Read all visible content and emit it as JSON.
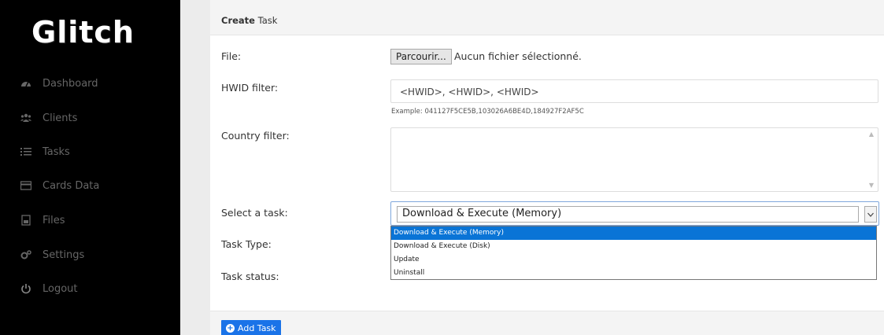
{
  "sidebar": {
    "logo": "Glitch",
    "items": [
      {
        "label": "Dashboard",
        "icon": "dashboard-icon"
      },
      {
        "label": "Clients",
        "icon": "users-icon"
      },
      {
        "label": "Tasks",
        "icon": "list-icon"
      },
      {
        "label": "Cards Data",
        "icon": "credit-card-icon"
      },
      {
        "label": "Files",
        "icon": "file-icon"
      },
      {
        "label": "Settings",
        "icon": "gears-icon"
      },
      {
        "label": "Logout",
        "icon": "power-icon"
      }
    ]
  },
  "card": {
    "title_bold": "Create",
    "title_rest": " Task"
  },
  "form": {
    "file_label": "File:",
    "file_button": "Parcourir...",
    "file_status": "Aucun fichier sélectionné.",
    "hwid_label": "HWID filter:",
    "hwid_value": "<HWID>, <HWID>, <HWID>",
    "hwid_hint": "Example: 041127F5CE5B,103026A6BE4D,184927F2AF5C",
    "country_label": "Country filter:",
    "country_value": "",
    "task_label": "Select a task:",
    "task_selected": "Download & Execute (Memory)",
    "task_options": [
      "Download & Execute (Memory)",
      "Download & Execute (Disk)",
      "Update",
      "Uninstall"
    ],
    "task_type_label": "Task Type:",
    "task_status_label": "Task status:"
  },
  "footer": {
    "add_button": "Add Task"
  },
  "colors": {
    "sidebar_bg": "#000000",
    "accent": "#1a73e8",
    "selected_option": "#0a74d6"
  }
}
